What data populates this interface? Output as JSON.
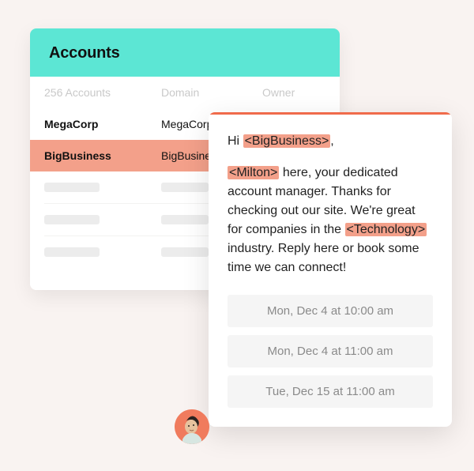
{
  "accounts": {
    "title": "Accounts",
    "count_label": "256 Accounts",
    "columns": {
      "domain": "Domain",
      "owner": "Owner"
    },
    "rows": [
      {
        "name": "MegaCorp",
        "domain": "MegaCorp.com",
        "highlight": false
      },
      {
        "name": "BigBusiness",
        "domain": "BigBusiness.com",
        "highlight": true
      }
    ]
  },
  "chat": {
    "accent_color": "#f06b4b",
    "greeting_prefix": "Hi ",
    "greeting_suffix": ",",
    "token_company": "<BigBusiness>",
    "body_part1_pre": "",
    "token_rep": "<Milton>",
    "body_part1_mid": " here, your dedicated account manager. Thanks for checking out our site. We're great for companies in the ",
    "token_industry": "<Technology>",
    "body_part1_post": " industry. Reply here or book some time we can connect!",
    "slots": [
      "Mon, Dec 4 at 10:00 am",
      "Mon, Dec 4 at 11:00 am",
      "Tue, Dec 15 at 11:00 am"
    ]
  },
  "avatar": {
    "label": "rep-avatar"
  }
}
